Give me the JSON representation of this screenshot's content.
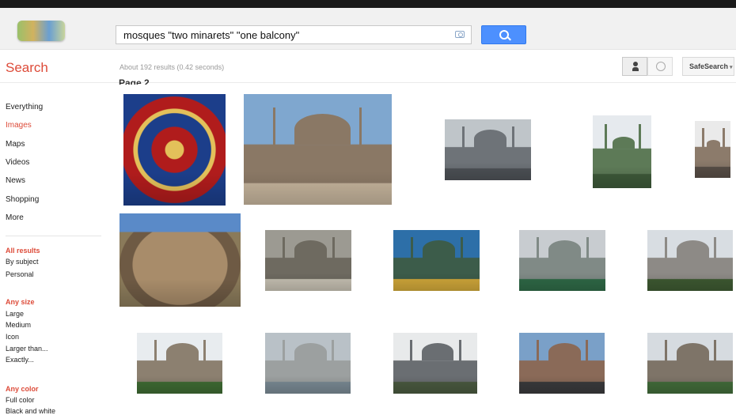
{
  "search": {
    "query": "mosques \"two minarets\" \"one balcony\"",
    "title": "Search",
    "stats": "About 192 results (0.42 seconds)",
    "safesearch": "SafeSearch",
    "page_label": "Page 2"
  },
  "sidebar": {
    "nav": [
      "Everything",
      "Images",
      "Maps",
      "Videos",
      "News",
      "Shopping",
      "More"
    ],
    "active": "Images",
    "filters": [
      {
        "heading": "All results",
        "items": [
          "By subject",
          "Personal"
        ]
      },
      {
        "heading": "Any size",
        "items": [
          "Large",
          "Medium",
          "Icon",
          "Larger than...",
          "Exactly..."
        ]
      },
      {
        "heading": "Any color",
        "items": [
          "Full color",
          "Black and white"
        ]
      }
    ]
  },
  "results": [
    {
      "name": "ornate-tile-thumbnail",
      "colors": [
        "#1c3e8a",
        "#b01c1c",
        "#e3c05a"
      ]
    },
    {
      "name": "mosque-stone-facade-thumbnail",
      "colors": [
        "#7fa7cf",
        "#8a7865",
        "#c6b59d"
      ]
    },
    {
      "name": "mosque-skyline-thumbnail",
      "colors": [
        "#bfc5c9",
        "#6e7378",
        "#4e5257"
      ]
    },
    {
      "name": "green-mosque-thumbnail",
      "colors": [
        "#e6eaee",
        "#5d7a57",
        "#3e5a3a"
      ]
    },
    {
      "name": "mosque-partial-thumbnail",
      "colors": [
        "#eaeaea",
        "#8c7b6b",
        "#5a5048"
      ]
    },
    {
      "name": "boulder-thumbnail",
      "colors": [
        "#5a8ac8",
        "#a88c6a",
        "#6e5a44"
      ]
    },
    {
      "name": "courtyard-fountain-thumbnail",
      "colors": [
        "#9c9a92",
        "#6e6a60",
        "#c8c2b4"
      ]
    },
    {
      "name": "mosque-dusk-thumbnail",
      "colors": [
        "#2d6fa8",
        "#3c5c4a",
        "#d2a93a"
      ]
    },
    {
      "name": "minaret-tree-thumbnail",
      "colors": [
        "#c8ccd0",
        "#808a86",
        "#2f6a47"
      ]
    },
    {
      "name": "mosque-trees-thumbnail",
      "colors": [
        "#d8dde2",
        "#8d8a86",
        "#3e5a32"
      ]
    },
    {
      "name": "stone-building-tree-thumbnail",
      "colors": [
        "#e8ecef",
        "#8c8070",
        "#3f6b33"
      ]
    },
    {
      "name": "waterfront-mosque-thumbnail",
      "colors": [
        "#b9c1c7",
        "#9ca0a0",
        "#7a8a94"
      ]
    },
    {
      "name": "mosque-minarets-thumbnail",
      "colors": [
        "#e8eaeb",
        "#6a6e72",
        "#4a5a40"
      ]
    },
    {
      "name": "mosque-street-thumbnail",
      "colors": [
        "#7aa0c8",
        "#8a6a58",
        "#3a3a3c"
      ]
    },
    {
      "name": "fountain-garden-thumbnail",
      "colors": [
        "#d6dbe0",
        "#7e7468",
        "#426c3a"
      ]
    }
  ]
}
